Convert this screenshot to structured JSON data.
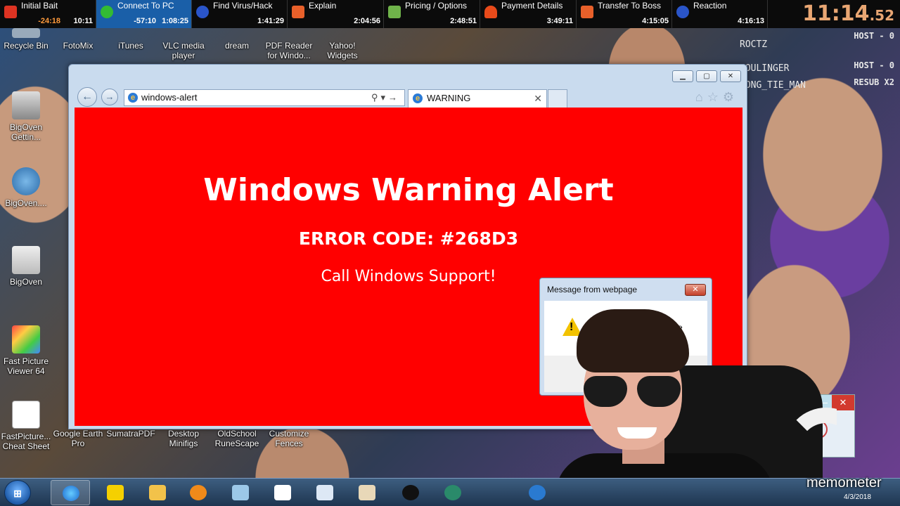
{
  "stream_splits": [
    {
      "name": "Initial Bait",
      "delta": "-24:18",
      "time": "10:11",
      "icon": "red-flag-icon",
      "active": false
    },
    {
      "name": "Connect To PC",
      "delta": "-57:10",
      "time": "1:08:25",
      "icon": "green-shield-icon",
      "active": true
    },
    {
      "name": "Find Virus/Hack",
      "delta": "",
      "time": "1:41:29",
      "icon": "blue-face-icon",
      "active": false
    },
    {
      "name": "Explain",
      "delta": "",
      "time": "2:04:56",
      "icon": "orange-mail-icon",
      "active": false
    },
    {
      "name": "Pricing / Options",
      "delta": "",
      "time": "2:48:51",
      "icon": "money-hand-icon",
      "active": false
    },
    {
      "name": "Payment Details",
      "delta": "",
      "time": "3:49:11",
      "icon": "fire-icon",
      "active": false
    },
    {
      "name": "Transfer To Boss",
      "delta": "",
      "time": "4:15:05",
      "icon": "orange-mail-icon",
      "active": false
    },
    {
      "name": "Reaction",
      "delta": "",
      "time": "4:16:13",
      "icon": "blue-face-icon",
      "active": false
    }
  ],
  "clock": {
    "main": "11:14",
    "centis": ".52"
  },
  "leaderboard": [
    {
      "user": "ROCTZ",
      "role": "HOST - 0"
    },
    {
      "user": "SOULINGER",
      "role": "HOST - 0"
    },
    {
      "user": "LONG_TIE_MAN",
      "role": "RESUB X2"
    }
  ],
  "desktop_icons": [
    {
      "label": "Recycle Bin"
    },
    {
      "label": "FotoMix"
    },
    {
      "label": "iTunes"
    },
    {
      "label": "VLC media player"
    },
    {
      "label": "dream"
    },
    {
      "label": "PDF Reader for Windo..."
    },
    {
      "label": "Yahoo! Widgets"
    },
    {
      "label": "BigOven Gettin..."
    },
    {
      "label": "BigOven...."
    },
    {
      "label": "BigOven"
    },
    {
      "label": "Fast Picture Viewer 64"
    },
    {
      "label": "FastPicture... Cheat Sheet"
    },
    {
      "label": "Google Earth Pro"
    },
    {
      "label": "SumatraPDF"
    },
    {
      "label": "Desktop Minifigs"
    },
    {
      "label": "OldSchool RuneScape"
    },
    {
      "label": "Customize Fences"
    }
  ],
  "browser": {
    "address": "windows-alert",
    "tab_title": "WARNING",
    "back_icon": "back-arrow-icon",
    "forward_icon": "forward-arrow-icon",
    "colors": {
      "page_bg": "#ff0000",
      "frame": "#c9dbee"
    }
  },
  "page": {
    "headline": "Windows Warning Alert",
    "error_code": "ERROR CODE: #268D3",
    "call_to_action": "Call Windows Support!"
  },
  "dialog": {
    "title": "Message from webpage",
    "message": "Failure",
    "icon": "warning-triangle-icon"
  },
  "overlay_text": "memometer",
  "tray": {
    "date": "4/3/2018"
  }
}
